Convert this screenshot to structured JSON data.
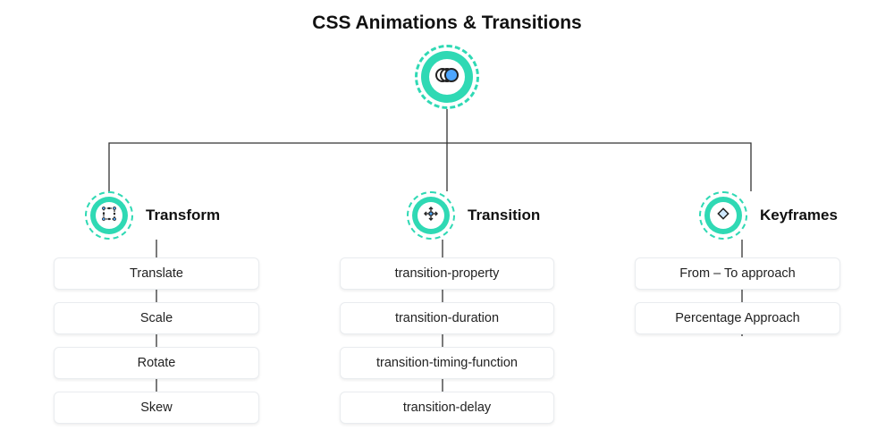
{
  "title": "CSS Animations & Transitions",
  "root": {
    "icon": "cascade-icon"
  },
  "branches": [
    {
      "label": "Transform",
      "icon": "grid-transform-icon",
      "items": [
        "Translate",
        "Scale",
        "Rotate",
        "Skew"
      ]
    },
    {
      "label": "Transition",
      "icon": "expand-arrows-icon",
      "items": [
        "transition-property",
        "transition-duration",
        "transition-timing-function",
        "transition-delay"
      ]
    },
    {
      "label": "Keyframes",
      "icon": "diamond-keyframe-icon",
      "items": [
        "From – To approach",
        "Percentage Approach"
      ]
    }
  ]
}
